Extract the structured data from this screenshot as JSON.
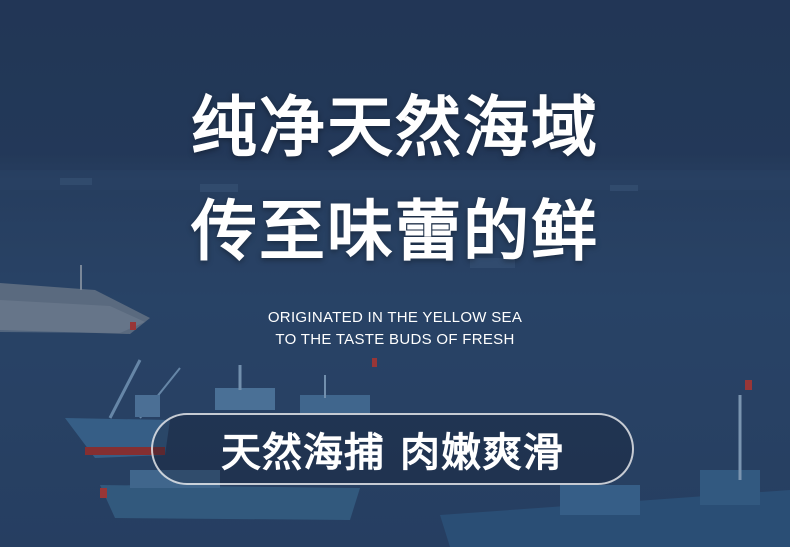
{
  "banner": {
    "headline_line1": "纯净天然海域",
    "headline_line2": "传至味蕾的鲜",
    "english_line1": "ORIGINATED IN THE YELLOW SEA",
    "english_line2": "TO THE TASTE BUDS OF FRESH",
    "tagline": "天然海捕 肉嫩爽滑"
  },
  "colors": {
    "sky": "#243a5c",
    "sea": "#2d4b72",
    "text": "#ffffff"
  }
}
